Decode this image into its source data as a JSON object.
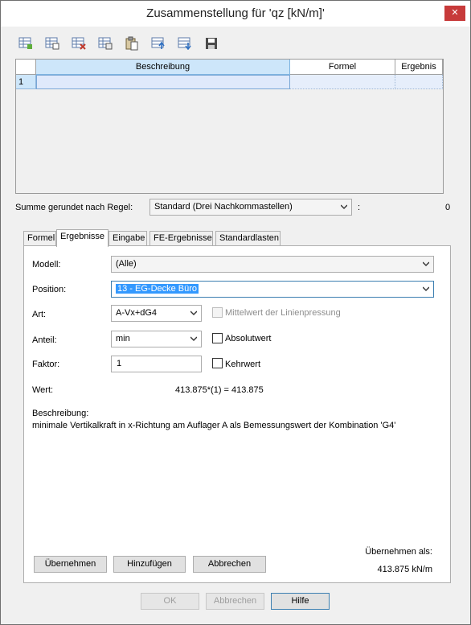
{
  "window": {
    "title": "Zusammenstellung für 'qz [kN/m]'",
    "close_glyph": "✕"
  },
  "toolbar": {
    "icons": [
      "insert-row-icon",
      "copy-row-icon",
      "delete-row-icon",
      "clear-row-icon",
      "paste-icon",
      "move-up-icon",
      "move-down-icon",
      "save-icon"
    ]
  },
  "grid": {
    "columns": [
      "Beschreibung",
      "Formel",
      "Ergebnis"
    ],
    "rows": [
      {
        "num": "1",
        "beschreibung": "",
        "formel": "",
        "ergebnis": ""
      }
    ]
  },
  "summe": {
    "label": "Summe gerundet nach Regel:",
    "rule_value": "Standard (Drei Nachkommastellen)",
    "colon": ":",
    "value": "0"
  },
  "tabs": [
    "Formel",
    "Ergebnisse",
    "Eingabe",
    "FE-Ergebnisse",
    "Standardlasten"
  ],
  "active_tab": "Ergebnisse",
  "form": {
    "modell_label": "Modell:",
    "modell_value": "(Alle)",
    "position_label": "Position:",
    "position_value": "13 - EG-Decke Büro",
    "art_label": "Art:",
    "art_value": "A-Vx+dG4",
    "mittelwert_label": "Mittelwert der Linienpressung",
    "anteil_label": "Anteil:",
    "anteil_value": "min",
    "absolutwert_label": "Absolutwert",
    "faktor_label": "Faktor:",
    "faktor_value": "1",
    "kehrwert_label": "Kehrwert",
    "wert_label": "Wert:",
    "wert_value": "413.875*(1) = 413.875",
    "beschreibung_label": "Beschreibung:",
    "beschreibung_text": "minimale Vertikalkraft in x-Richtung am Auflager A als Bemessungswert der Kombination 'G4'",
    "uebernehmen_als_label": "Übernehmen als:",
    "uebernehmen_als_value": "413.875 kN/m"
  },
  "panel_buttons": {
    "uebernehmen": "Übernehmen",
    "hinzufuegen": "Hinzufügen",
    "abbrechen": "Abbrechen"
  },
  "dialog_buttons": {
    "ok": "OK",
    "abbrechen": "Abbrechen",
    "hilfe": "Hilfe"
  },
  "colors": {
    "header_selected": "#cde6fa",
    "selection": "#3399ff",
    "close": "#c73a3a"
  }
}
